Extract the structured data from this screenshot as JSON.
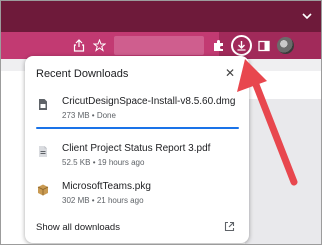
{
  "downloads": {
    "title": "Recent Downloads",
    "items": [
      {
        "name": "CricutDesignSpace-Install-v8.5.60.dmg",
        "meta": "273 MB • Done",
        "progress": 1.0
      },
      {
        "name": "Client Project Status Report 3.pdf",
        "meta": "52.5 KB • 19 hours ago"
      },
      {
        "name": "MicrosoftTeams.pkg",
        "meta": "302 MB • 21 hours ago"
      }
    ],
    "show_all": "Show all downloads"
  },
  "colors": {
    "tab_strip": "#6e1a3a",
    "toolbar": "#a12a5a",
    "progress": "#1a73e8",
    "annotation_arrow": "#e8474e"
  },
  "icons": {
    "toolbar": [
      "share-icon",
      "bookmark-star-icon",
      "extensions-puzzle-icon",
      "download-icon",
      "side-panel-icon",
      "profile-avatar"
    ],
    "tab_strip": [
      "chevron-down-icon"
    ]
  }
}
